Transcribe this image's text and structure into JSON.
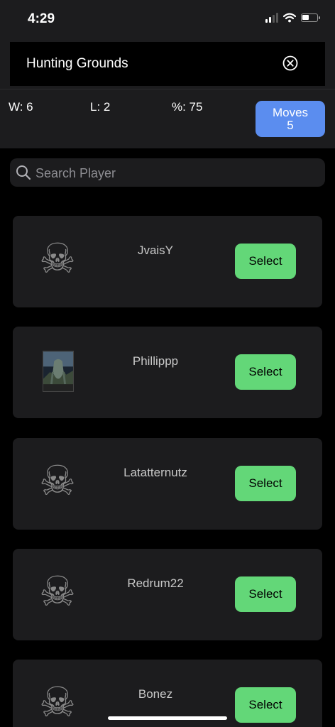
{
  "status_bar": {
    "time": "4:29"
  },
  "header": {
    "title": "Hunting Grounds",
    "close_icon": "close-circle-icon"
  },
  "stats": {
    "wins": "W: 6",
    "losses": "L: 2",
    "percent": "%: 75",
    "moves_label": "Moves",
    "moves_value": "5"
  },
  "search": {
    "placeholder": "Search Player",
    "icon": "search-icon"
  },
  "players": [
    {
      "name": "JvaisY",
      "avatar": "skull-icon",
      "select_label": "Select"
    },
    {
      "name": "Phillippp",
      "avatar": "photo",
      "select_label": "Select"
    },
    {
      "name": "Latatternutz",
      "avatar": "skull-icon",
      "select_label": "Select"
    },
    {
      "name": "Redrum22",
      "avatar": "skull-icon",
      "select_label": "Select"
    },
    {
      "name": "Bonez",
      "avatar": "skull-icon",
      "select_label": "Select"
    }
  ],
  "colors": {
    "accent_blue": "#5b8def",
    "select_green": "#63d778",
    "card_bg": "#1c1c1e"
  }
}
